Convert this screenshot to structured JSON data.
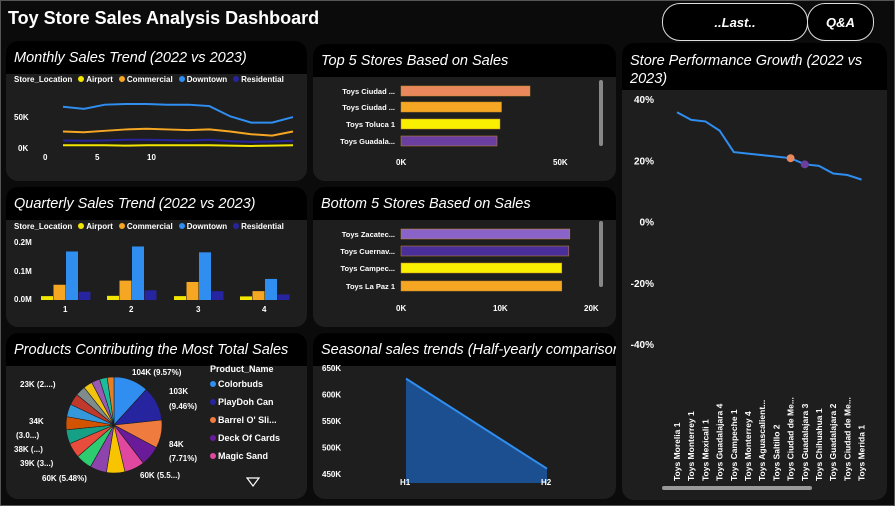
{
  "header": {
    "title": "Toy Store Sales Analysis Dashboard",
    "bookmark_label": "..Last..",
    "qa_label": "Q&A"
  },
  "colors": {
    "airport": "#f2e600",
    "commercial": "#f5a623",
    "downtown": "#2f8ef0",
    "residential": "#26249e"
  },
  "monthly": {
    "title": "Monthly Sales Trend (2022 vs 2023)",
    "legend_title": "Store_Location",
    "legend": [
      "Airport",
      "Commercial",
      "Downtown",
      "Residential"
    ],
    "y_ticks": [
      "50K",
      "0K"
    ],
    "x_ticks": [
      "0",
      "5",
      "10"
    ],
    "chart_data": {
      "type": "line",
      "x": [
        1,
        2,
        3,
        4,
        5,
        6,
        7,
        8,
        9,
        10,
        11,
        12
      ],
      "ylim": [
        0,
        80000
      ],
      "series": [
        {
          "name": "Airport",
          "values": [
            4000,
            4000,
            4000,
            3500,
            4000,
            4000,
            4000,
            4000,
            3500,
            3000,
            3500,
            4000
          ]
        },
        {
          "name": "Commercial",
          "values": [
            24000,
            23000,
            25000,
            27000,
            28000,
            27000,
            26000,
            27000,
            24000,
            20000,
            18000,
            24000
          ]
        },
        {
          "name": "Downtown",
          "values": [
            60000,
            57000,
            63000,
            64000,
            64000,
            63000,
            63000,
            61000,
            46000,
            37000,
            37000,
            45000
          ]
        },
        {
          "name": "Residential",
          "values": [
            11000,
            10500,
            11000,
            12000,
            12000,
            11500,
            11000,
            12000,
            10000,
            9000,
            9500,
            10500
          ]
        }
      ]
    }
  },
  "quarterly": {
    "title": "Quarterly Sales Trend (2022 vs 2023)",
    "legend_title": "Store_Location",
    "legend": [
      "Airport",
      "Commercial",
      "Downtown",
      "Residential"
    ],
    "y_ticks": [
      "0.2M",
      "0.1M",
      "0.0M"
    ],
    "chart_data": {
      "type": "bar",
      "categories": [
        "1",
        "2",
        "3",
        "4"
      ],
      "ylim": [
        0,
        220000
      ],
      "series": [
        {
          "name": "Airport",
          "values": [
            14000,
            15000,
            14000,
            13000
          ]
        },
        {
          "name": "Commercial",
          "values": [
            55000,
            70000,
            65000,
            32000
          ]
        },
        {
          "name": "Downtown",
          "values": [
            175000,
            193000,
            172000,
            76000
          ]
        },
        {
          "name": "Residential",
          "values": [
            30000,
            35000,
            32000,
            20000
          ]
        }
      ]
    }
  },
  "top5": {
    "title": "Top 5 Stores Based on Sales",
    "x_ticks": [
      "0K",
      "50K"
    ],
    "chart_data": {
      "type": "bar",
      "categories": [
        "Toys Ciudad ...",
        "Toys Ciudad ...",
        "Toys Toluca 1",
        "Toys Guadala..."
      ],
      "values": [
        43000,
        33500,
        33000,
        32000
      ],
      "xlim": [
        0,
        64000
      ],
      "colors": [
        "#e8885c",
        "#f5a623",
        "#f8f000",
        "#6b3fa0"
      ]
    }
  },
  "bottom5": {
    "title": "Bottom 5 Stores Based on Sales",
    "x_ticks": [
      "0K",
      "10K",
      "20K"
    ],
    "chart_data": {
      "type": "bar",
      "categories": [
        "Toys Zacatec...",
        "Toys Cuernav...",
        "Toys Campec...",
        "Toys La Paz 1"
      ],
      "values": [
        16800,
        16700,
        16000,
        16000
      ],
      "xlim": [
        0,
        20000
      ],
      "colors": [
        "#8a63c9",
        "#4a2f9a",
        "#f8f000",
        "#f5a623"
      ]
    }
  },
  "growth": {
    "title": "Store Performance Growth (2022 vs 2023)",
    "y_ticks": [
      "40%",
      "20%",
      "0%",
      "-20%",
      "-40%"
    ],
    "chart_data": {
      "type": "line",
      "categories": [
        "Toys Morelia 1",
        "Toys Monterrey 1",
        "Toys Mexicali 1",
        "Toys Guadalajara 4",
        "Toys Campeche 1",
        "Toys Monterrey 4",
        "Toys Aguascalient...",
        "Toys Saltillo 2",
        "Toys Ciudad de Me...",
        "Toys Guadalajara 3",
        "Toys Chihuahua 1",
        "Toys Guadalajara 2",
        "Toys Ciudad de Me...",
        "Toys Merida 1"
      ],
      "values": [
        36,
        33.5,
        33,
        30,
        23,
        22.5,
        22,
        21.5,
        21,
        19,
        18.5,
        16,
        15.5,
        14
      ],
      "ylim": [
        -45,
        42
      ]
    }
  },
  "products": {
    "title": "Products Contributing the Most Total Sales",
    "legend_title": "Product_Name",
    "legend": [
      {
        "name": "Colorbuds",
        "color": "#2f8ef0"
      },
      {
        "name": "PlayDoh Can",
        "color": "#26249e"
      },
      {
        "name": "Barrel O' Sli...",
        "color": "#f07b3f"
      },
      {
        "name": "Deck Of Cards",
        "color": "#6a1b9a"
      },
      {
        "name": "Magic Sand",
        "color": "#e0479e"
      }
    ],
    "labels": [
      "104K (9.57%)",
      "103K",
      "(9.46%)",
      "84K",
      "(7.71%)",
      "60K (5.5...)",
      "60K (5.48%)",
      "23K (2....)",
      "34K",
      "(3.0...)",
      "38K (...)",
      "39K (3...)"
    ],
    "chart_data": {
      "type": "pie",
      "values": [
        104,
        103,
        84,
        60,
        60,
        55,
        50,
        48,
        45,
        42,
        39,
        38,
        34,
        30,
        27,
        25,
        23,
        20
      ],
      "colors": [
        "#2f8ef0",
        "#26249e",
        "#f07b3f",
        "#6a1b9a",
        "#e0479e",
        "#f8c400",
        "#8e44ad",
        "#2ecc71",
        "#e74c3c",
        "#16a085",
        "#d35400",
        "#3498db",
        "#c0392b",
        "#7f8c8d",
        "#f1c40f",
        "#9b59b6",
        "#1abc9c",
        "#e67e22"
      ]
    }
  },
  "seasonal": {
    "title": "Seasonal sales trends (Half-yearly comparison)",
    "y_ticks": [
      "650K",
      "600K",
      "550K",
      "500K",
      "450K"
    ],
    "chart_data": {
      "type": "area",
      "categories": [
        "H1",
        "H2"
      ],
      "values": [
        630000,
        460000
      ],
      "ylim": [
        445000,
        655000
      ]
    }
  }
}
